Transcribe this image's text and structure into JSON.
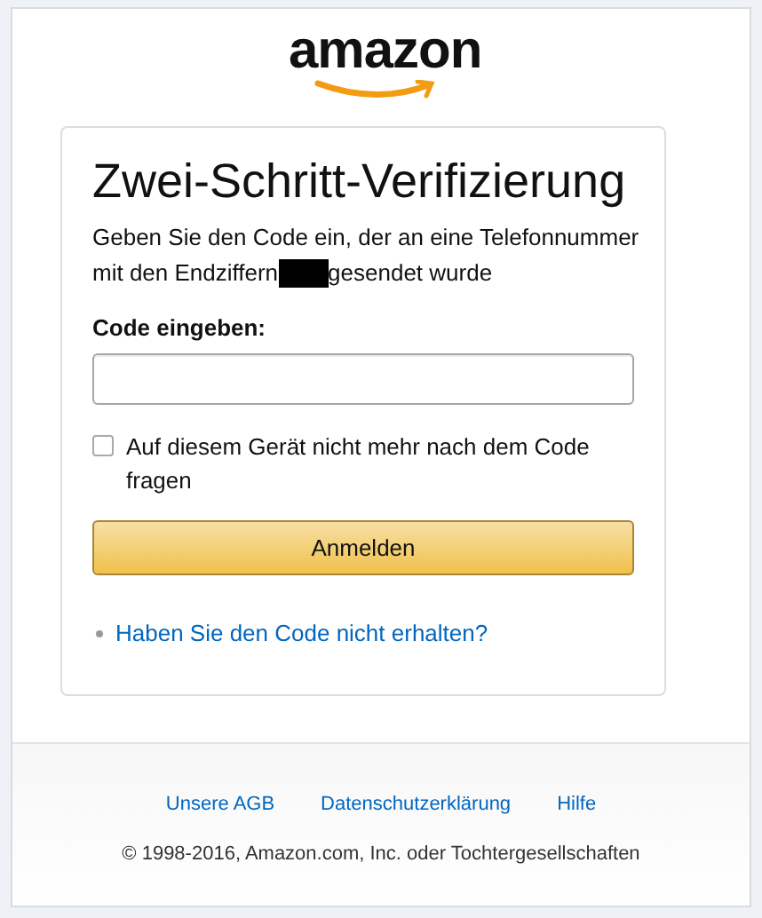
{
  "logo": {
    "text": "amazon"
  },
  "card": {
    "title": "Zwei-Schritt-Verifizierung",
    "instruction": [
      "Geben Sie den Code ein, der an eine Telefonnummer",
      "mit den Endziffern",
      "gesendet wurde"
    ],
    "redacted": true,
    "code_field": {
      "label": "Code eingeben:"
    },
    "remember": {
      "label": "Auf diesem Gerät nicht mehr nach dem Code fragen",
      "checked": false
    },
    "submit": "Anmelden",
    "help_link": "Haben Sie den Code nicht erhalten?"
  },
  "footer": {
    "links": [
      "Unsere AGB",
      "Datenschutzerklärung",
      "Hilfe"
    ],
    "copyright": "© 1998-2016, Amazon.com, Inc. oder Tochtergesellschaften"
  }
}
